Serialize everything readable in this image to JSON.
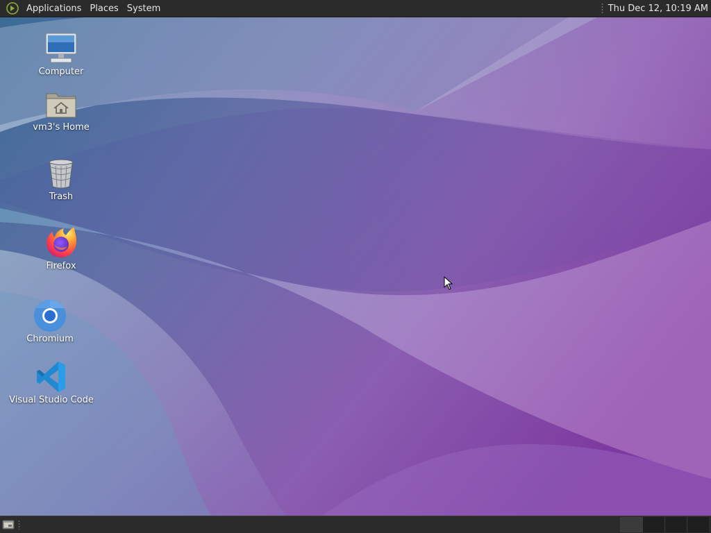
{
  "top_panel": {
    "menus": [
      {
        "label": "Applications"
      },
      {
        "label": "Places"
      },
      {
        "label": "System"
      }
    ],
    "clock": "Thu Dec 12, 10:19 AM"
  },
  "desktop": {
    "icons": [
      {
        "label": "Computer",
        "icon": "computer-icon"
      },
      {
        "label": "vm3's Home",
        "icon": "home-folder-icon"
      },
      {
        "label": "Trash",
        "icon": "trash-icon"
      },
      {
        "label": "Firefox",
        "icon": "firefox-icon"
      },
      {
        "label": "Chromium",
        "icon": "chromium-icon"
      },
      {
        "label": "Visual Studio Code",
        "icon": "vscode-icon"
      }
    ]
  },
  "bottom_panel": {
    "show_desktop_icon": "show-desktop-icon",
    "workspaces": 4,
    "active_workspace": 1
  },
  "colors": {
    "panel": "#2b2b2b",
    "wallpaper_blue": "#3b6394",
    "wallpaper_purple": "#8a3fa6"
  }
}
